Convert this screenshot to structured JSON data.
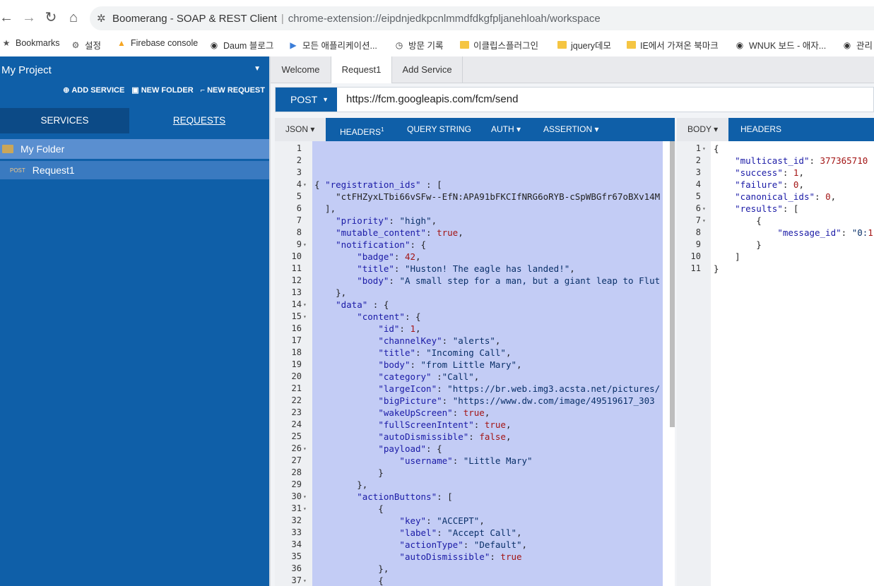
{
  "browser": {
    "tab_title": "Boomerang - SOAP & REST Client",
    "url": "chrome-extension://eipdnjedkpcnlmmdfdkgfpljanehloah/workspace",
    "bookmarks": [
      {
        "label": "Bookmarks",
        "icon": "star-icon"
      },
      {
        "label": "설정",
        "icon": "gear-icon"
      },
      {
        "label": "Firebase console",
        "icon": "firebase-icon"
      },
      {
        "label": "Daum 블로그",
        "icon": "globe-icon"
      },
      {
        "label": "모든 애플리케이션...",
        "icon": "play-icon"
      },
      {
        "label": "방문 기록",
        "icon": "history-icon"
      },
      {
        "label": "이클립스플러그인",
        "icon": "folder-icon"
      },
      {
        "label": "jquery데모",
        "icon": "folder-icon"
      },
      {
        "label": "IE에서 가져온 북마크",
        "icon": "folder-icon"
      },
      {
        "label": "WNUK 보드 - 애자...",
        "icon": "globe-icon"
      },
      {
        "label": "관리",
        "icon": "globe-icon"
      }
    ]
  },
  "sidebar": {
    "project": "My Project",
    "actions": [
      "ADD SERVICE",
      "NEW FOLDER",
      "NEW REQUEST"
    ],
    "tabs": [
      "SERVICES",
      "REQUESTS"
    ],
    "folder": "My Folder",
    "request_method": "POST",
    "request_name": "Request1"
  },
  "tabs": [
    "Welcome",
    "Request1",
    "Add Service"
  ],
  "request": {
    "method": "POST",
    "url": "https://fcm.googleapis.com/fcm/send"
  },
  "request_pane": {
    "tabs": [
      "JSON",
      "HEADERS",
      "QUERY STRING",
      "AUTH",
      "ASSERTION"
    ],
    "headers_count": "1"
  },
  "response_pane": {
    "tabs": [
      "BODY",
      "HEADERS"
    ]
  },
  "request_code": [
    "",
    "",
    "",
    "{ \"registration_ids\" : [",
    "    \"ctFHZyxLTbi66vSFw--EfN:APA91bFKCIfNRG6oRYB-cSpWBGfr67oBXv14M",
    "  ],",
    "    \"priority\": \"high\",",
    "    \"mutable_content\": true,",
    "    \"notification\": {",
    "        \"badge\": 42,",
    "        \"title\": \"Huston! The eagle has landed!\",",
    "        \"body\": \"A small step for a man, but a giant leap to Flut",
    "    },",
    "    \"data\" : {",
    "        \"content\": {",
    "            \"id\": 1,",
    "            \"channelKey\": \"alerts\",",
    "            \"title\": \"Incoming Call\",",
    "            \"body\": \"from Little Mary\",",
    "            \"category\" :\"Call\",",
    "            \"largeIcon\": \"https://br.web.img3.acsta.net/pictures/",
    "            \"bigPicture\": \"https://www.dw.com/image/49519617_303",
    "            \"wakeUpScreen\": true,",
    "            \"fullScreenIntent\": true,",
    "            \"autoDismissible\": false,",
    "            \"payload\": {",
    "                \"username\": \"Little Mary\"",
    "            }",
    "        },",
    "        \"actionButtons\": [",
    "            {",
    "                \"key\": \"ACCEPT\",",
    "                \"label\": \"Accept Call\",",
    "                \"actionType\": \"Default\",",
    "                \"autoDismissible\": true",
    "            },",
    "            {"
  ],
  "response_code": [
    "{",
    "    \"multicast_id\": 377365710",
    "    \"success\": 1,",
    "    \"failure\": 0,",
    "    \"canonical_ids\": 0,",
    "    \"results\": [",
    "        {",
    "            \"message_id\": \"0:1",
    "        }",
    "    ]",
    "}"
  ],
  "request_folds": [
    4,
    9,
    14,
    15,
    26,
    30,
    31,
    37
  ],
  "response_folds": [
    1,
    6,
    7
  ]
}
